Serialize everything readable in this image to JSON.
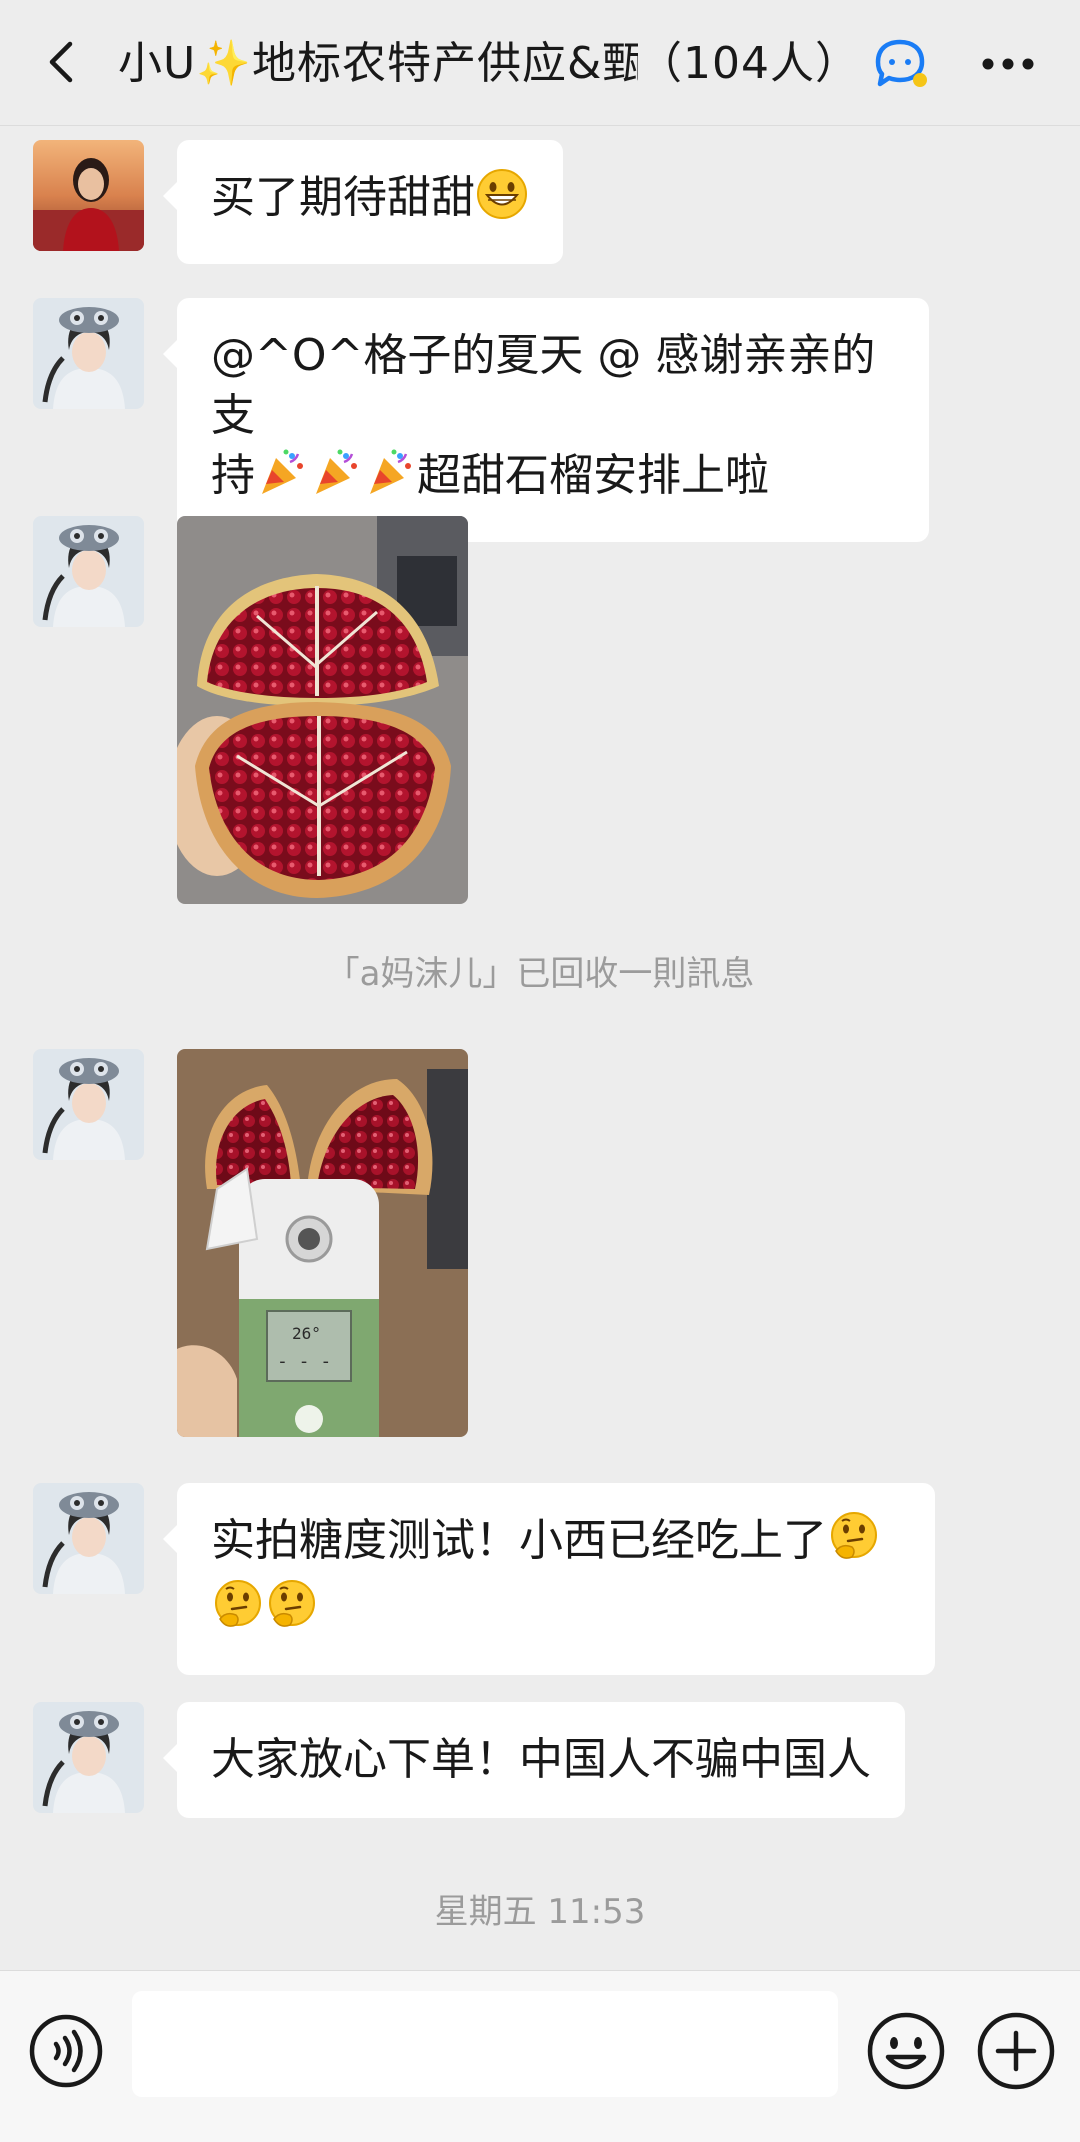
{
  "header": {
    "title_name": "小U✨地标农特产供应&甄",
    "title_count": "（104人）",
    "back_icon": "chevron-left-icon",
    "chat_icon": "chat-bubble-icon",
    "more_icon": "more-dots-icon"
  },
  "messages": [
    {
      "text": "买了期待甜甜",
      "emoji": "grinning-face"
    },
    {
      "text_line1": "@^O^格子的夏天 @ 感谢亲亲的支",
      "text_line2_a": "持",
      "text_line2_b": "超甜石榴安排上啦",
      "emoji": "party-popper"
    },
    {
      "image": "pomegranate-opened-photo"
    },
    {
      "image": "brix-meter-pomegranate-photo"
    },
    {
      "text_line1": "实拍糖度测试！小西已经吃上了",
      "emoji": "thinking-face"
    },
    {
      "text": "大家放心下单！中国人不骗中国人"
    }
  ],
  "system": {
    "recall_notice": "「a妈沫儿」已回收一則訊息",
    "timestamp": "星期五 11:53"
  },
  "input_bar": {
    "placeholder": "",
    "voice_icon": "voice-icon",
    "emoji_icon": "emoji-icon",
    "plus_icon": "plus-icon"
  },
  "colors": {
    "background": "#ededed",
    "bubble": "#ffffff",
    "system_text": "#9b9b9b",
    "accent": "#1a7cf5"
  }
}
